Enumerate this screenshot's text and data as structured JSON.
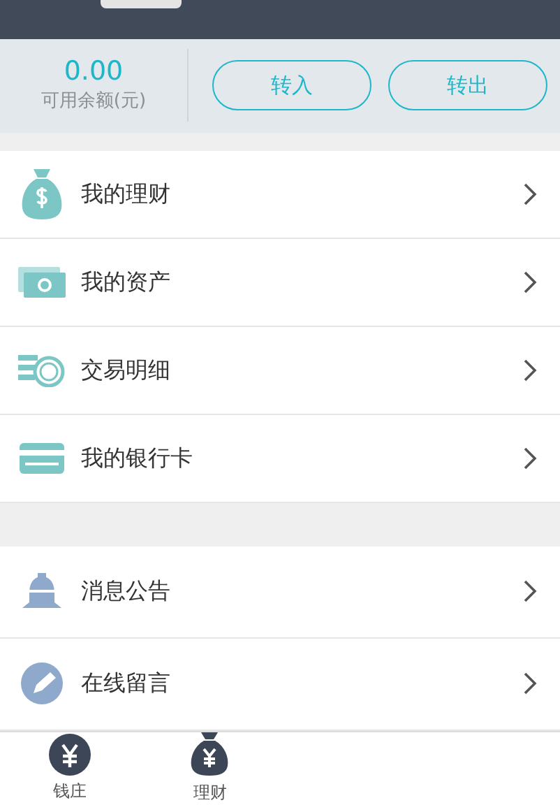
{
  "balance": {
    "amount": "0.00",
    "label": "可用余额(元)"
  },
  "actions": [
    "转入",
    "转出"
  ],
  "sections": [
    {
      "items": [
        "我的理财",
        "我的资产",
        "交易明细",
        "我的银行卡"
      ]
    },
    {
      "items": [
        "消息公告",
        "在线留言"
      ]
    }
  ],
  "tab_bar": [
    {
      "label": "钱庄",
      "selected": false
    },
    {
      "label": "理财",
      "selected": false
    }
  ]
}
